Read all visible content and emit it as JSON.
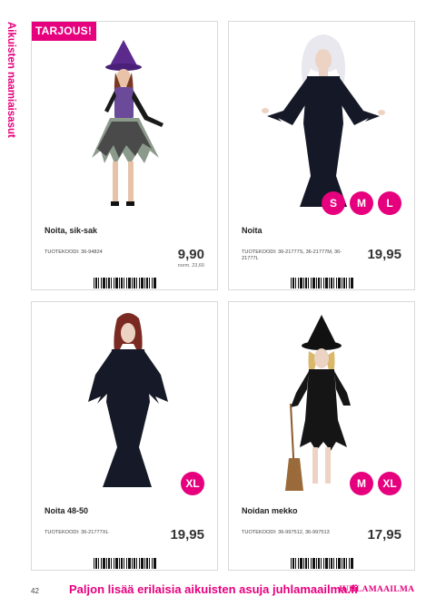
{
  "side_label": "Aikuisten naamiaisasut",
  "products": [
    {
      "badge": "TARJOUS!",
      "title": "Noita, sik-sak",
      "code": "TUOTEKOODI: 36-94824",
      "price": "9,90",
      "norm": "norm. 23,60",
      "sizes": []
    },
    {
      "title": "Noita",
      "code": "TUOTEKOODI: 36-21777S, 36-21777M, 36-21777L",
      "price": "19,95",
      "sizes": [
        "S",
        "M",
        "L"
      ]
    },
    {
      "title": "Noita  48-50",
      "code": "TUOTEKOODI: 36-21777XL",
      "price": "19,95",
      "sizes": [
        "XL"
      ]
    },
    {
      "title": "Noidan mekko",
      "code": "TUOTEKOODI: 36-997512, 36-997513",
      "price": "17,95",
      "sizes": [
        "M",
        "XL"
      ]
    }
  ],
  "footer": {
    "page_number": "42",
    "text": "Paljon lisää erilaisia aikuisten asuja juhlamaailma.fi",
    "logo": "JUHLAMAAILMA"
  },
  "colors": {
    "accent": "#e6007e"
  }
}
